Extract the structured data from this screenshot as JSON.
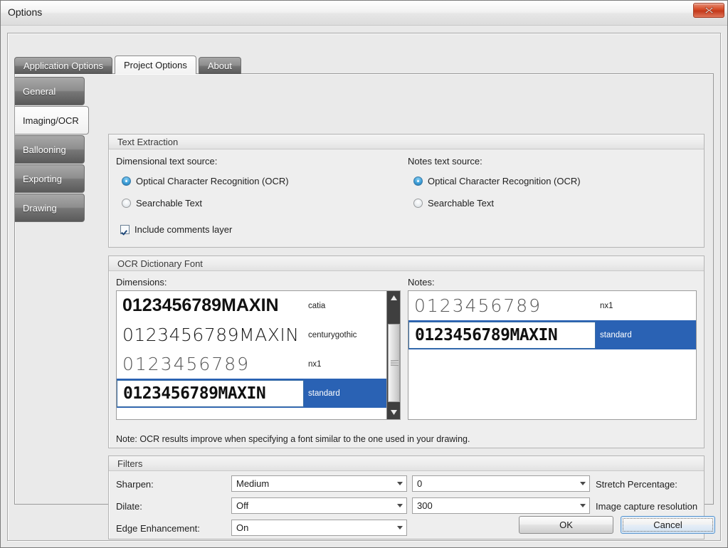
{
  "window": {
    "title": "Options",
    "close_icon": "close-icon"
  },
  "tabs": [
    {
      "label": "Application Options",
      "selected": false
    },
    {
      "label": "Project Options",
      "selected": true
    },
    {
      "label": "About",
      "selected": false
    }
  ],
  "side_tabs": [
    {
      "label": "General",
      "selected": false
    },
    {
      "label": "Imaging/OCR",
      "selected": true
    },
    {
      "label": "Ballooning",
      "selected": false
    },
    {
      "label": "Exporting",
      "selected": false
    },
    {
      "label": "Drawing",
      "selected": false
    }
  ],
  "text_extraction": {
    "group_title": "Text Extraction",
    "dimensional_label": "Dimensional text source:",
    "dimensional_options": [
      {
        "label": "Optical Character Recognition (OCR)",
        "selected": true
      },
      {
        "label": "Searchable Text",
        "selected": false
      }
    ],
    "notes_label": "Notes text source:",
    "notes_options": [
      {
        "label": "Optical Character Recognition (OCR)",
        "selected": true
      },
      {
        "label": "Searchable Text",
        "selected": false
      }
    ],
    "include_comments": {
      "label": "Include comments layer",
      "checked": true
    }
  },
  "ocr_dictionary_font": {
    "group_title": "OCR Dictionary Font",
    "dimensions_label": "Dimensions:",
    "notes_label": "Notes:",
    "sample_text_long": "0123456789MAXIN",
    "sample_text_short": "0123456789",
    "dimensions_items": [
      {
        "sample": "0123456789MAXIN",
        "label": "catia",
        "selected": false
      },
      {
        "sample": "0123456789MAXIN",
        "label": "centurygothic",
        "selected": false
      },
      {
        "sample": "0123456789",
        "label": "nx1",
        "selected": false
      },
      {
        "sample": "0123456789MAXIN",
        "label": "standard",
        "selected": true
      }
    ],
    "notes_items": [
      {
        "sample": "0123456789",
        "label": "nx1",
        "selected": false
      },
      {
        "sample": "0123456789MAXIN",
        "label": "standard",
        "selected": true
      }
    ],
    "note": "Note:  OCR results improve when specifying a font similar to the one used in your drawing.",
    "scrollbar": {
      "up_icon": "scroll-up-icon",
      "down_icon": "scroll-down-icon"
    }
  },
  "filters": {
    "group_title": "Filters",
    "rows": [
      {
        "label": "Sharpen:",
        "value": "Medium",
        "right_value": "0",
        "right_label": "Stretch Percentage:"
      },
      {
        "label": "Dilate:",
        "value": "Off",
        "right_value": "300",
        "right_label": "Image capture resolution"
      },
      {
        "label": "Edge Enhancement:",
        "value": "On",
        "right_value": "",
        "right_label": ""
      }
    ]
  },
  "buttons": {
    "ok": "OK",
    "cancel": "Cancel"
  },
  "colors": {
    "selection_blue": "#2a62b4",
    "close_red": "#c3391b",
    "window_gray": "#e9e9e9"
  }
}
